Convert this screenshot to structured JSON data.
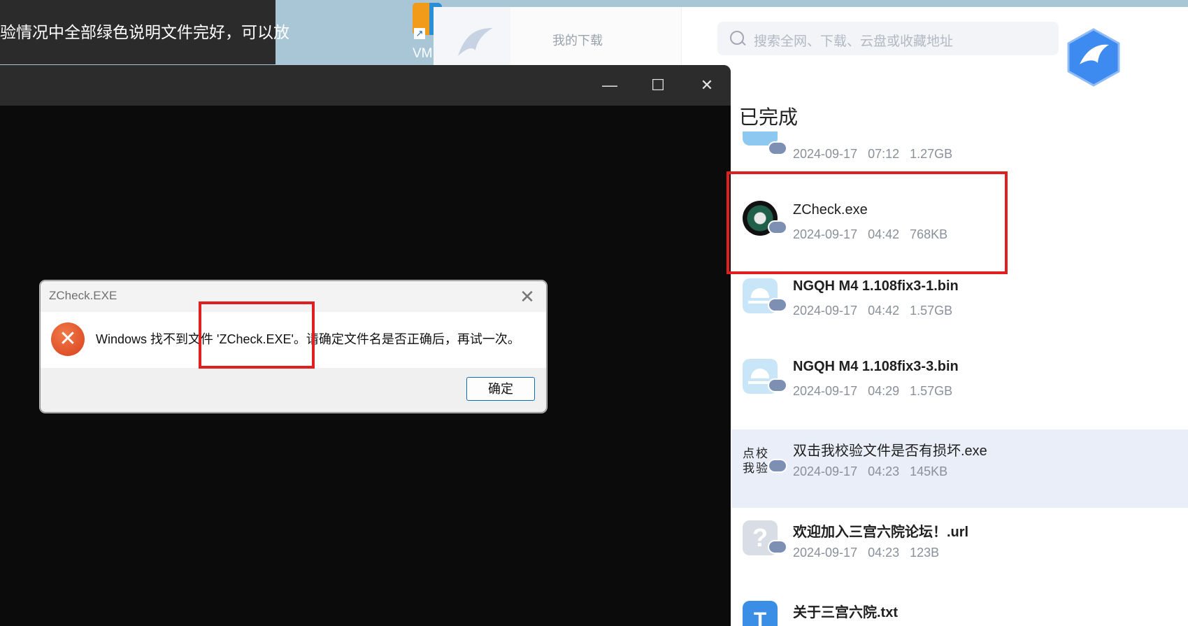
{
  "notice_text": "验情况中全部绿色说明文件完好，可以放",
  "desktop_icon": {
    "label": "VM",
    "icon": "shortcut-arrow-icon"
  },
  "download_manager": {
    "tab_label": "我的下载",
    "search_placeholder": "搜索全网、下载、云盘或收藏地址",
    "section_title": "已完成",
    "files": [
      {
        "name": "",
        "date": "2024-09-17 07:12",
        "size": "1.27GB",
        "icon": "folder-icon"
      },
      {
        "name": "ZCheck.exe",
        "date": "2024-09-17 04:42",
        "size": "768KB",
        "icon": "zcheck-app-icon"
      },
      {
        "name": "NGQH M4 1.108fix3-1.bin",
        "date": "2024-09-17 04:42",
        "size": "1.57GB",
        "icon": "bin-file-icon"
      },
      {
        "name": "NGQH M4 1.108fix3-3.bin",
        "date": "2024-09-17 04:29",
        "size": "1.57GB",
        "icon": "bin-file-icon"
      },
      {
        "name": "双击我校验文件是否有损坏.exe",
        "date": "2024-09-17 04:23",
        "size": "145KB",
        "icon": "exe-file-icon",
        "icon_text": "点校我验"
      },
      {
        "name": "欢迎加入三宫六院论坛！.url",
        "date": "2024-09-17 04:23",
        "size": "123B",
        "icon": "url-file-icon",
        "icon_text": "?"
      },
      {
        "name": "关于三宫六院.txt",
        "icon": "txt-file-icon",
        "icon_text": "T"
      }
    ]
  },
  "console_window": {
    "minimize": "—",
    "maximize": "☐",
    "close": "✕"
  },
  "dialog": {
    "title": "ZCheck.EXE",
    "close_glyph": "✕",
    "error_glyph": "✕",
    "message": "Windows 找不到文件 'ZCheck.EXE'。请确定文件名是否正确后，再试一次。",
    "ok_label": "确定"
  },
  "colors": {
    "highlight_box": "#e02020",
    "selected_row": "#e9eef9",
    "error_icon": "#d9401b"
  }
}
